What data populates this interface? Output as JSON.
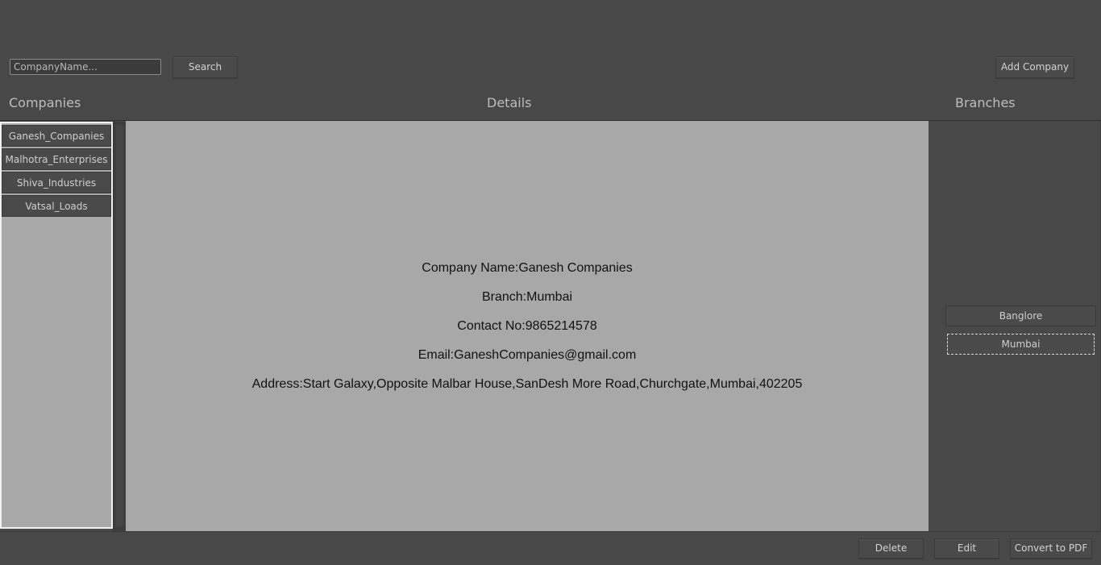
{
  "toolbar": {
    "search_placeholder": "CompanyName...",
    "search_label": "Search",
    "add_company_label": "Add Company"
  },
  "headers": {
    "companies": "Companies",
    "details": "Details",
    "branches": "Branches"
  },
  "companies": [
    {
      "label": "Ganesh_Companies"
    },
    {
      "label": "Malhotra_Enterprises"
    },
    {
      "label": "Shiva_Industries"
    },
    {
      "label": "Vatsal_Loads"
    }
  ],
  "details": {
    "company_name": "Company Name:Ganesh Companies",
    "branch": "Branch:Mumbai",
    "contact": "Contact No:9865214578",
    "email": "Email:GaneshCompanies@gmail.com",
    "address": "Address:Start Galaxy,Opposite Malbar House,SanDesh More Road,Churchgate,Mumbai,402205"
  },
  "branches": [
    {
      "label": "Banglore"
    },
    {
      "label": "Mumbai"
    }
  ],
  "selected_branch": "Mumbai",
  "actions": {
    "delete_label": "Delete",
    "edit_label": "Edit",
    "pdf_label": "Convert to PDF"
  },
  "colors": {
    "background": "#484848",
    "panel": "#a8a8a8",
    "button": "#4a4a4a",
    "text_light": "#cfcfcf"
  }
}
